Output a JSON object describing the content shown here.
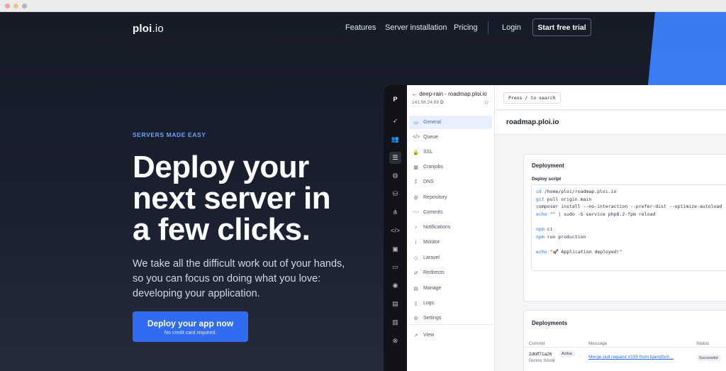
{
  "nav": {
    "logo_bold": "ploi",
    "logo_light": ".io",
    "features": "Features",
    "server_installation": "Server installation",
    "pricing": "Pricing",
    "login": "Login",
    "start_trial": "Start free trial"
  },
  "hero": {
    "eyebrow": "SERVERS MADE EASY",
    "headline_lines": [
      "Deploy your",
      "next server in",
      "a few clicks."
    ],
    "lead": "We take all the difficult work out of your hands, so you can focus on doing what you love: developing your application.",
    "cta_label": "Deploy your app now",
    "cta_sub": "No credit card required."
  },
  "app": {
    "icon_logo": "P",
    "icons": [
      "rocket-icon",
      "users-icon",
      "server-icon",
      "globe-icon",
      "database-icon",
      "network-icon",
      "code-icon",
      "save-icon",
      "archive-icon",
      "user-circle-icon",
      "server-stack-icon",
      "document-icon",
      "settings-icon"
    ],
    "server_title": "← deep-rain - roadmap.ploi.io",
    "server_ip": "141.98.24.89 ⧉",
    "sidenav": [
      {
        "label": "General",
        "icon": "card-icon",
        "glyph": "▭",
        "active": true
      },
      {
        "label": "Queue",
        "icon": "code-icon",
        "glyph": "</>"
      },
      {
        "label": "SSL",
        "icon": "lock-icon",
        "glyph": "🔒"
      },
      {
        "label": "Cronjobs",
        "icon": "calendar-icon",
        "glyph": "▦"
      },
      {
        "label": "DNS",
        "icon": "dns-icon",
        "glyph": "⁑"
      },
      {
        "label": "Repository",
        "icon": "repository-icon",
        "glyph": "⚙"
      },
      {
        "label": "Commits",
        "icon": "commit-icon",
        "glyph": "-○-"
      },
      {
        "label": "Notifications",
        "icon": "bell-icon",
        "glyph": "♪"
      },
      {
        "label": "Monitor",
        "icon": "monitor-icon",
        "glyph": "⌇"
      },
      {
        "label": "Laravel",
        "icon": "laravel-icon",
        "glyph": "◇"
      },
      {
        "label": "Redirects",
        "icon": "redirect-icon",
        "glyph": "⇄"
      },
      {
        "label": "Manage",
        "icon": "manage-icon",
        "glyph": "▤"
      },
      {
        "label": "Logs",
        "icon": "logs-icon",
        "glyph": "▯"
      },
      {
        "label": "Settings",
        "icon": "gear-icon",
        "glyph": "⚙"
      },
      {
        "label": "View",
        "icon": "external-link-icon",
        "glyph": "↗"
      }
    ],
    "search_label": "Press / to search",
    "site_name": "roadmap.ploi.io",
    "deployment": {
      "title": "Deployment",
      "script_label": "Deploy script",
      "script_lines": [
        "cd /home/ploi/roadmap.ploi.io",
        "git pull origin main",
        "composer install --no-interaction --prefer-dist --optimize-autoload",
        "echo \"\" | sudo -S service php8.2-fpm reload",
        "",
        "npm ci",
        "npm run production",
        "",
        "echo \"🚀 Application deployed!\""
      ]
    },
    "deployments": {
      "title": "Deployments",
      "columns": [
        "Commit",
        "Message",
        "Status"
      ],
      "rows": [
        {
          "commit": "2dbff71a26",
          "author": "Dennis Smink",
          "badge": "Active",
          "message": "Merge pull request #195 from bjarnjflx/n...",
          "status": "Successful"
        }
      ]
    }
  }
}
